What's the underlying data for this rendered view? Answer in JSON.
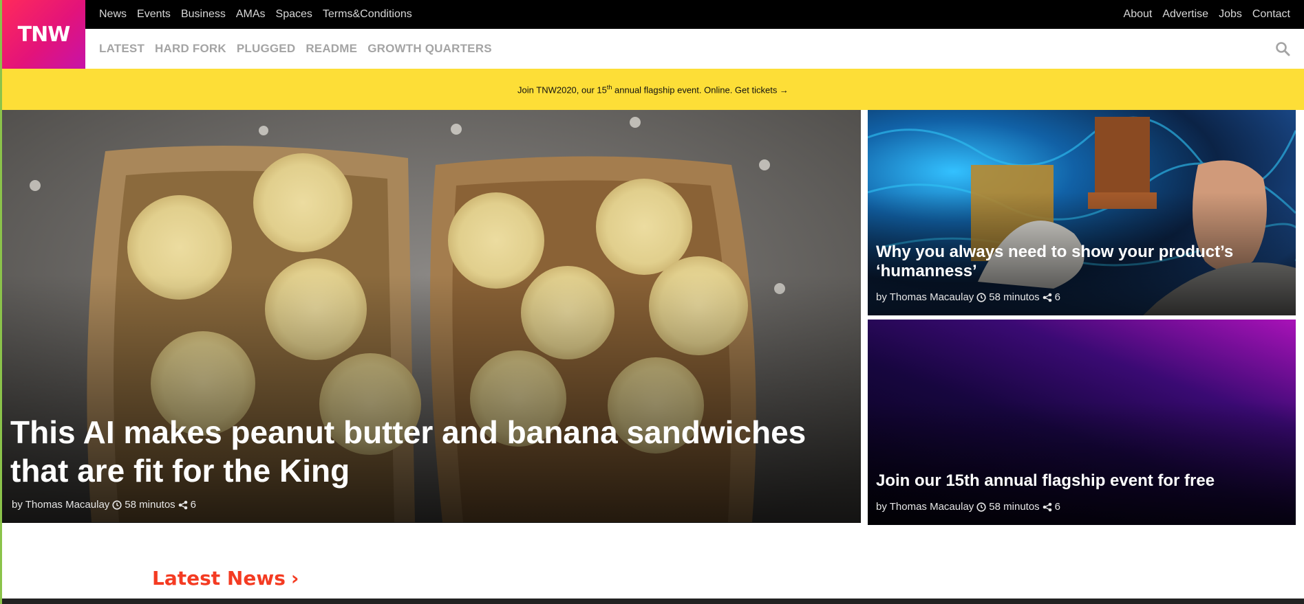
{
  "logo": {
    "text": "TNW"
  },
  "topnav": {
    "left": [
      "News",
      "Events",
      "Business",
      "AMAs",
      "Spaces",
      "Terms&Conditions"
    ],
    "right": [
      "About",
      "Advertise",
      "Jobs",
      "Contact"
    ]
  },
  "subnav": [
    "LATEST",
    "HARD FORK",
    "PLUGGED",
    "README",
    "GROWTH QUARTERS"
  ],
  "banner": {
    "part1": "Join TNW2020, our 15",
    "sup": "th",
    "part2": " annual flagship event. Online. Get tickets →"
  },
  "articles": {
    "hero": {
      "title": "This AI makes peanut butter and banana sandwiches that are fit for the King",
      "author": "by Thomas Macaulay",
      "time": "58 minutos",
      "shares": "6"
    },
    "side1": {
      "title": "Why you always need to show your product’s ‘humanness’",
      "author": "by Thomas Macaulay",
      "time": "58 minutos",
      "shares": "6"
    },
    "side2": {
      "title": "Join our 15th annual flagship event for free",
      "author": "by Thomas Macaulay",
      "time": "58 minutos",
      "shares": "6"
    }
  },
  "latest_news": {
    "heading": "Latest News",
    "arrow": "›"
  },
  "colors": {
    "banner": "#fdde37",
    "latest": "#f43b22",
    "logo": "#e3137a"
  },
  "icons": [
    "search-icon",
    "clock-icon",
    "share-icon",
    "chevron-right-icon"
  ]
}
